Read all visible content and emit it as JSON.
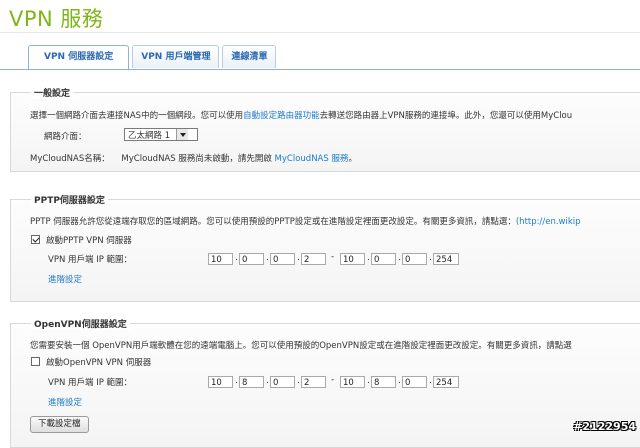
{
  "header": {
    "title": "VPN 服務"
  },
  "tabs": [
    {
      "label": "VPN 伺服器設定",
      "active": true
    },
    {
      "label": "VPN 用戶端管理",
      "active": false
    },
    {
      "label": "連線清單",
      "active": false
    }
  ],
  "general": {
    "legend": "一般設定",
    "desc_pre": "選擇一個網路介面去連接NAS中的一個網段。您可以使用",
    "desc_link": "自動設定路由器功能",
    "desc_post": "去轉送您路由器上VPN服務的連接埠。此外，您還可以使用MyClou",
    "interface_label": "網路介面：",
    "interface_value": "乙太網路 1",
    "mycloud_label": "MyCloudNAS名稱：",
    "mycloud_text": "MyCloudNAS 服務尚未啟動，請先開啟",
    "mycloud_link": "MyCloudNAS 服務",
    "mycloud_tail": "。"
  },
  "pptp": {
    "legend": "PPTP伺服器設定",
    "desc": "PPTP 伺服器允許您從遠端存取您的區域網路。您可以使用預設的PPTP設定或在進階設定裡面更改設定。有關更多資訊，請點選：",
    "desc_link": "(http://en.wikip",
    "enable_label": "啟動PPTP VPN 伺服器",
    "enabled": true,
    "ip_label": "VPN 用戶端 IP 範圍：",
    "ip_start": [
      "10",
      "0",
      "0",
      "2"
    ],
    "ip_end": [
      "10",
      "0",
      "0",
      "254"
    ],
    "advanced_link": "進階設定"
  },
  "openvpn": {
    "legend": "OpenVPN伺服器設定",
    "desc": "您需要安裝一個 OpenVPN用戶端軟體在您的遠端電腦上。您可以使用預設的OpenVPN設定或在進階設定裡面更改設定。有關更多資訊，請點選",
    "enable_label": "啟動OpenVPN VPN 伺服器",
    "enabled": false,
    "ip_label": "VPN 用戶端 IP 範圍：",
    "ip_start": [
      "10",
      "8",
      "0",
      "2"
    ],
    "ip_end": [
      "10",
      "8",
      "0",
      "254"
    ],
    "advanced_link": "進階設定",
    "download_button": "下載設定檔"
  },
  "watermark": "#2122954"
}
